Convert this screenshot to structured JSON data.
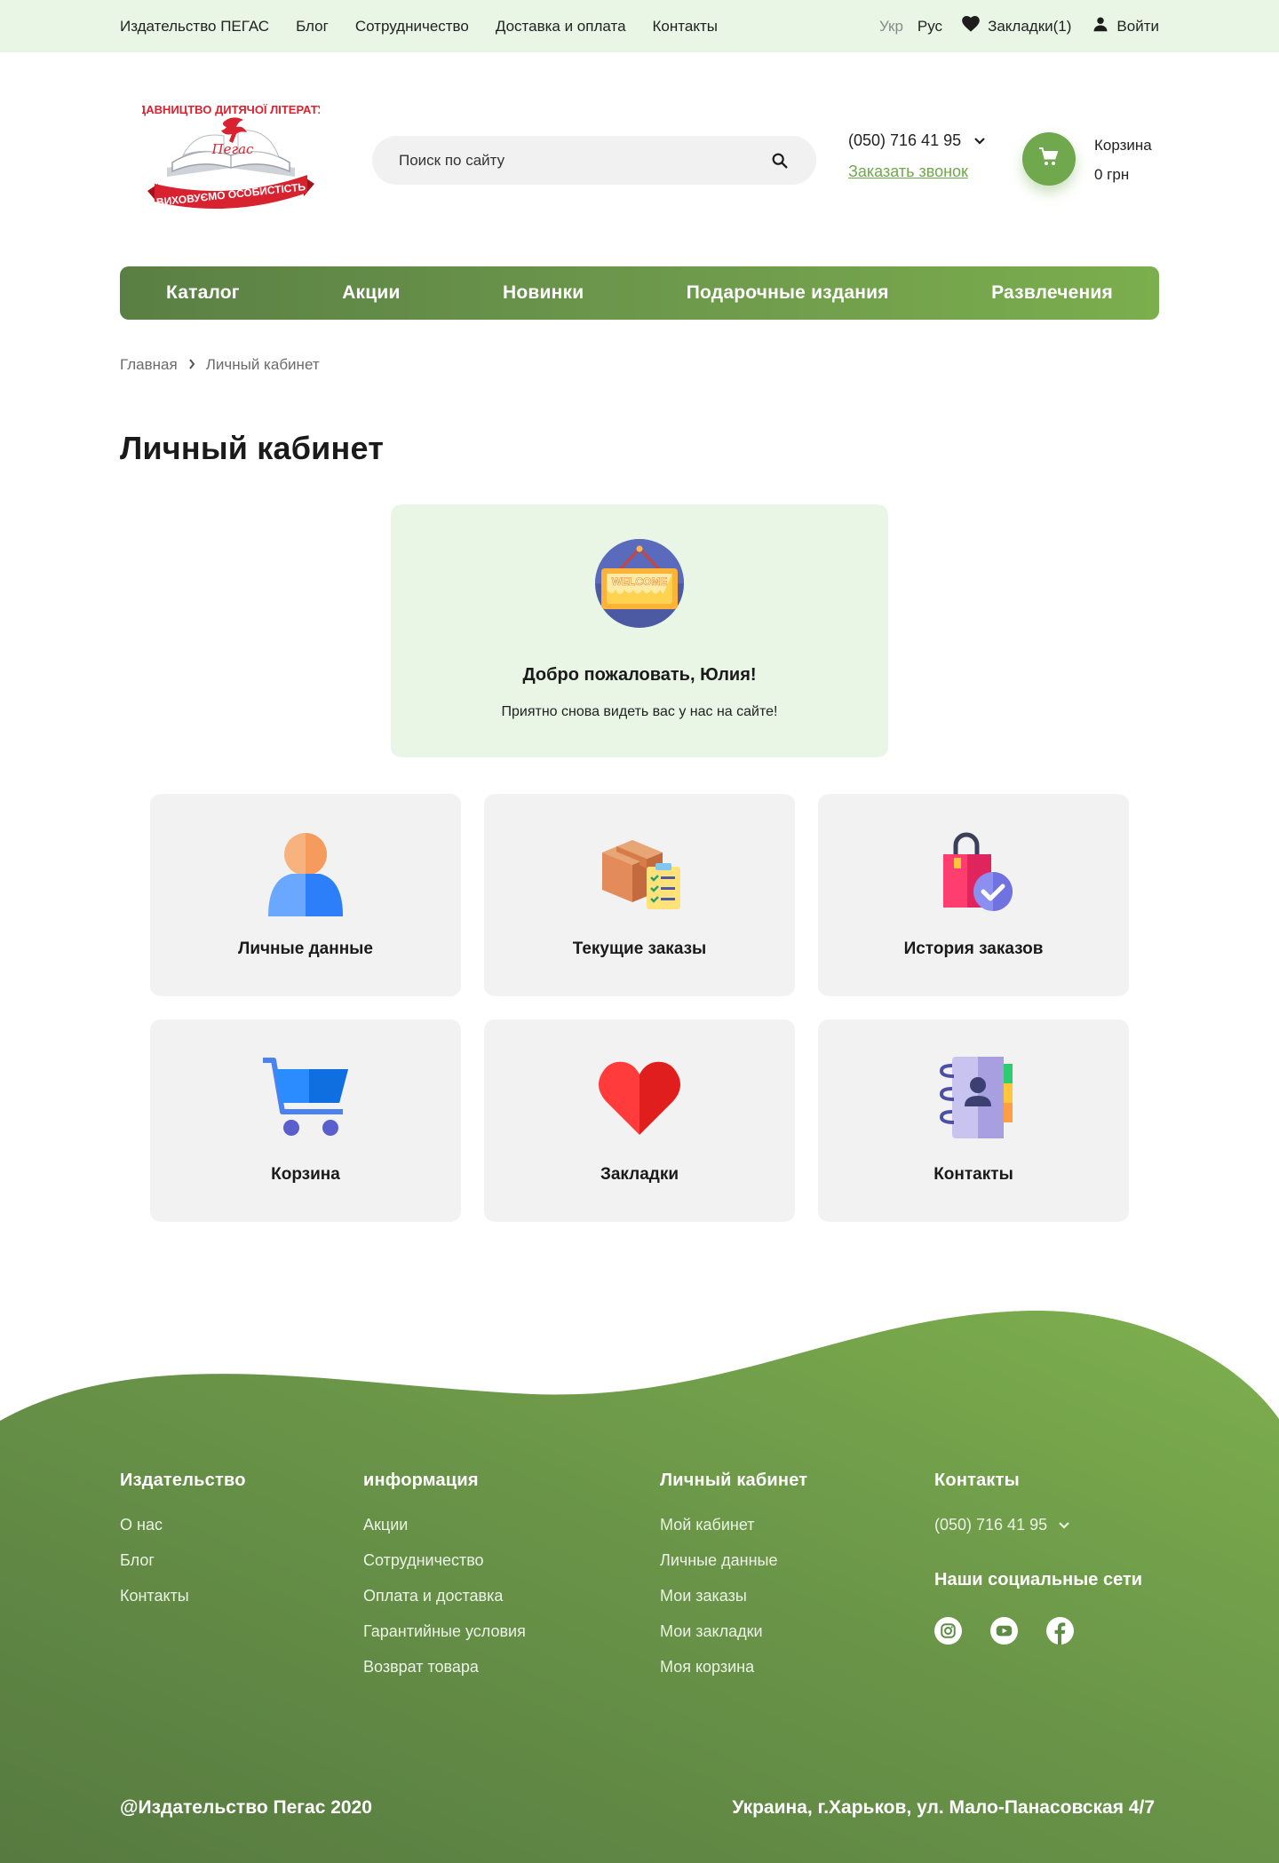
{
  "topbar": {
    "nav": [
      "Издательство ПЕГАС",
      "Блог",
      "Сотрудничество",
      "Доставка и оплата",
      "Контакты"
    ],
    "lang_ukr": "Укр",
    "lang_rus": "Рус",
    "bookmarks": "Закладки(1)",
    "login": "Войти"
  },
  "header": {
    "logo_text_top": "ВИДАВНИЦТВО ДИТЯЧОЇ ЛІТЕРАТУРИ",
    "logo_text_bottom": "ВИХОВУЄМО ОСОБИСТІСТЬ",
    "logo_text_book": "Пегас",
    "search_placeholder": "Поиск по сайту",
    "phone": "(050) 716 41 95",
    "callback": "Заказать звонок",
    "cart_label": "Корзина",
    "cart_sum": "0 грн"
  },
  "menu": [
    "Каталог",
    "Акции",
    "Новинки",
    "Подарочные издания",
    "Развлечения"
  ],
  "breadcrumb": {
    "home": "Главная",
    "current": "Личный кабинет"
  },
  "page_title": "Личный кабинет",
  "welcome": {
    "sign_text": "WELCOME",
    "title": "Добро пожаловать, Юлия!",
    "subtitle": "Приятно снова видеть вас у нас на сайте!"
  },
  "tiles": [
    {
      "label": "Личные данные",
      "icon": "user-icon"
    },
    {
      "label": "Текущие заказы",
      "icon": "box-clipboard-icon"
    },
    {
      "label": "История заказов",
      "icon": "shopping-bag-check-icon"
    },
    {
      "label": "Корзина",
      "icon": "cart-icon"
    },
    {
      "label": "Закладки",
      "icon": "heart-icon"
    },
    {
      "label": "Контакты",
      "icon": "address-book-icon"
    }
  ],
  "footer": {
    "col1": {
      "title": "Издательство",
      "links": [
        "О нас",
        "Блог",
        "Контакты"
      ]
    },
    "col2": {
      "title": "информация",
      "links": [
        "Акции",
        "Сотрудничество",
        "Оплата и доставка",
        "Гарантийные условия",
        "Возврат товара"
      ]
    },
    "col3": {
      "title": "Личный кабинет",
      "links": [
        "Мой кабинет",
        "Личные данные",
        "Мои заказы",
        "Мои закладки",
        "Моя корзина"
      ]
    },
    "col4": {
      "title": "Контакты",
      "phone": "(050) 716 41 95",
      "social_title": "Наши социальные сети"
    },
    "copyright": "@Издательство Пегас 2020",
    "address": "Украина,  г.Харьков, ул. Мало-Панасовская 4/7"
  },
  "colors": {
    "accent_green": "#6fa84d",
    "light_green_bg": "#e9f6e6",
    "tile_bg": "#f2f2f2"
  }
}
